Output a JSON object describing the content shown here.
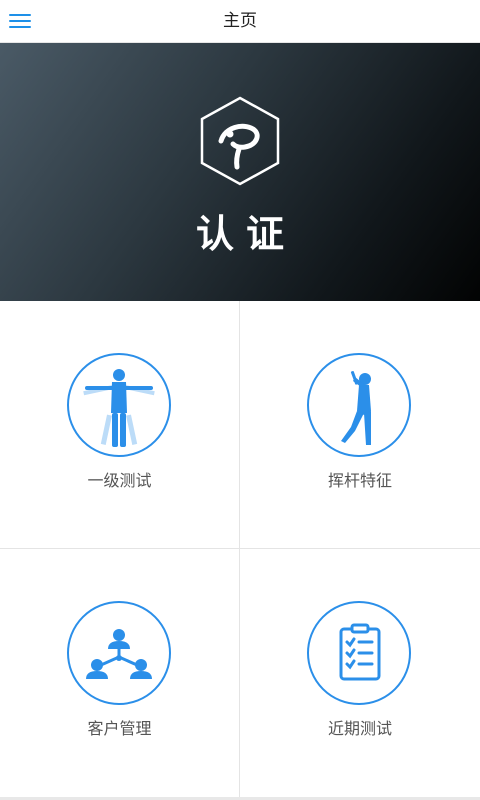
{
  "header": {
    "title": "主页",
    "menu_icon": "hamburger-menu-icon",
    "accent": "#1e90e8"
  },
  "hero": {
    "title": "认证",
    "logo_icon": "hexagon-p-logo"
  },
  "grid": {
    "items": [
      {
        "label": "一级测试",
        "icon": "vitruvian-body-icon"
      },
      {
        "label": "挥杆特征",
        "icon": "golfer-swing-icon"
      },
      {
        "label": "客户管理",
        "icon": "client-network-icon"
      },
      {
        "label": "近期测试",
        "icon": "clipboard-checklist-icon"
      }
    ]
  },
  "colors": {
    "icon_blue": "#2b8fe9",
    "hero_dark": "#11171b"
  }
}
